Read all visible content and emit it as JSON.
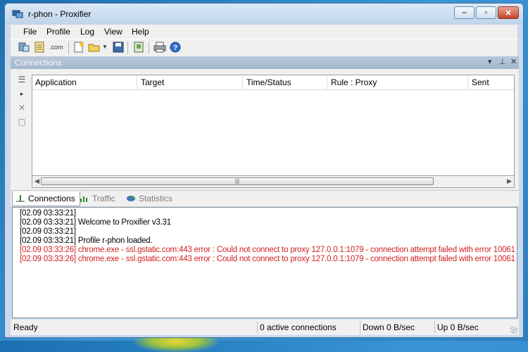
{
  "window": {
    "title": "r-phon - Proxifier"
  },
  "menu": [
    "File",
    "Profile",
    "Log",
    "View",
    "Help"
  ],
  "toolbar": {
    "icons": [
      "proxy-servers-icon",
      "proxification-rules-icon",
      "name-resolution-icon",
      "new-profile-icon",
      "open-profile-icon",
      "dropdown-arrow-icon",
      "save-profile-icon",
      "advanced-icon",
      "print-icon",
      "help-icon"
    ]
  },
  "connections_panel": {
    "title": "Connections",
    "columns": [
      "Application",
      "Target",
      "Time/Status",
      "Rule : Proxy",
      "Sent"
    ]
  },
  "tabs": [
    {
      "label": "Connections",
      "active": true
    },
    {
      "label": "Traffic",
      "active": false
    },
    {
      "label": "Statistics",
      "active": false
    }
  ],
  "log": [
    {
      "text": "[02.09 03:33:21]",
      "type": "normal"
    },
    {
      "text": "[02.09 03:33:21]     Welcome to Proxifier v3.31",
      "type": "normal"
    },
    {
      "text": "[02.09 03:33:21]",
      "type": "normal"
    },
    {
      "text": "[02.09 03:33:21] Profile r-phon loaded.",
      "type": "normal"
    },
    {
      "text": "[02.09 03:33:26] chrome.exe - ssl.gstatic.com:443 error : Could not connect to proxy 127.0.0.1:1079 - connection attempt failed with error 10061",
      "type": "error"
    },
    {
      "text": "[02.09 03:33:26] chrome.exe - ssl.gstatic.com:443 error : Could not connect to proxy 127.0.0.1:1079 - connection attempt failed with error 10061",
      "type": "error"
    }
  ],
  "status": {
    "state": "Ready",
    "active_connections": "0 active connections",
    "down": "Down 0 B/sec",
    "up": "Up 0 B/sec"
  },
  "colors": {
    "error_text": "#d22020",
    "title_bar": "#c7daee"
  }
}
